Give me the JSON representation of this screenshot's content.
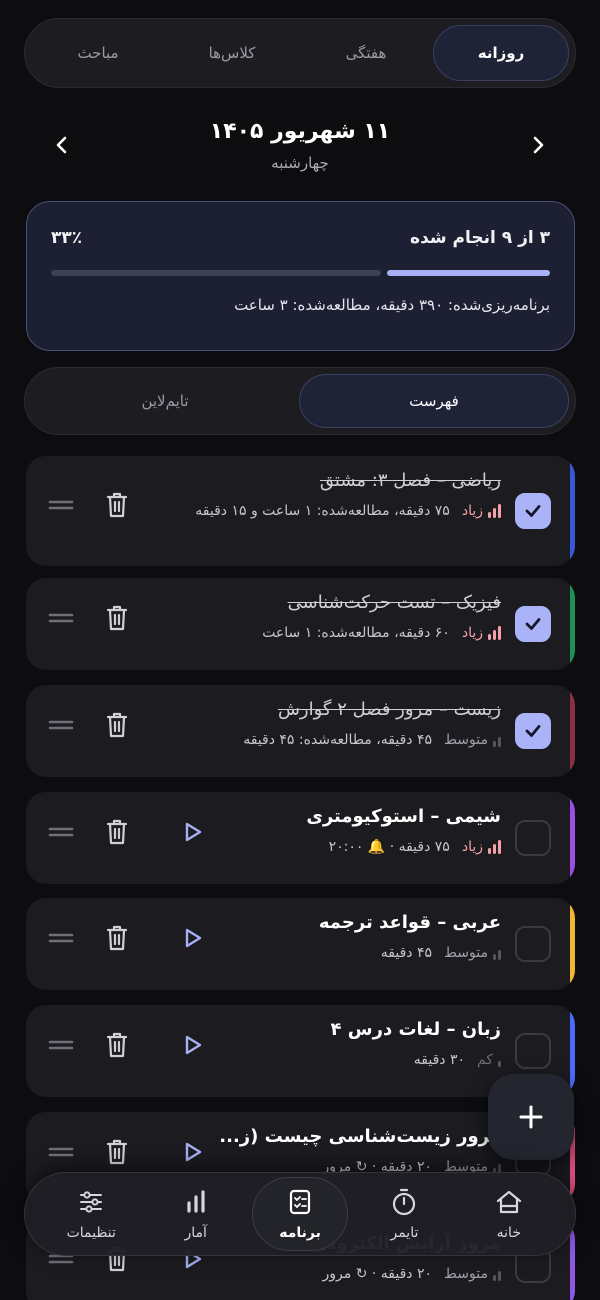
{
  "view_tabs": [
    {
      "label": "روزانه",
      "active": true
    },
    {
      "label": "هفتگی",
      "active": false
    },
    {
      "label": "کلاس‌ها",
      "active": false
    },
    {
      "label": "مباحث",
      "active": false
    }
  ],
  "date": {
    "title": "۱۱ شهریور ۱۴۰۵",
    "weekday": "چهارشنبه"
  },
  "progress": {
    "done_text": "۳ از ۹ انجام شده",
    "percent_text": "۳۳٪",
    "fraction": 0.33,
    "summary": "برنامه‌ریزی‌شده: ۳۹۰ دقیقه، مطالعه‌شده: ۳ ساعت"
  },
  "mode_toggle": {
    "list": "فهرست",
    "timeline": "تایم‌لاین"
  },
  "priority_labels": {
    "high": "زیاد",
    "mid": "متوسط",
    "low": "کم"
  },
  "tasks": [
    {
      "title": "ریاضی – فصل ۳: مشتق",
      "done": true,
      "priority": "زیاد",
      "meta": "۷۵ دقیقه، مطالعه‌شده: ۱ ساعت و ۱۵ دقیقه",
      "color": "#3b57d6"
    },
    {
      "title": "فیزیک – تست حرکت‌شناسی",
      "done": true,
      "priority": "زیاد",
      "meta": "۶۰ دقیقه، مطالعه‌شده: ۱ ساعت",
      "color": "#1f8f58"
    },
    {
      "title": "زیست – مرور فصل ۲ گوارش",
      "done": true,
      "priority": "متوسط",
      "meta": "۴۵ دقیقه، مطالعه‌شده: ۴۵ دقیقه",
      "color": "#8c2f45"
    },
    {
      "title": "شیمی – استوکیومتری",
      "done": false,
      "priority": "زیاد",
      "meta": "۷۵ دقیقه · 🔔 ۲۰:۰۰",
      "color": "#9a4fe0"
    },
    {
      "title": "عربی – قواعد ترجمه",
      "done": false,
      "priority": "متوسط",
      "meta": "۴۵ دقیقه",
      "color": "#f2b632"
    },
    {
      "title": "زبان – لغات درس ۴",
      "done": false,
      "priority": "کم",
      "meta": "۳۰ دقیقه",
      "color": "#4b6bff"
    },
    {
      "title": "مرور زیست‌شناسی چیست (ز...",
      "done": false,
      "priority": "متوسط",
      "meta": "۲۰ دقیقه · ↻ مرور",
      "color": "#e64f82"
    },
    {
      "title": "مرور آرایش الکترونی",
      "done": false,
      "priority": "متوسط",
      "meta": "۲۰ دقیقه · ↻ مرور",
      "color": "#8e57e6"
    }
  ],
  "bottom_nav": [
    {
      "label": "خانه",
      "icon": "home-icon",
      "active": false
    },
    {
      "label": "تایمر",
      "icon": "timer-icon",
      "active": false
    },
    {
      "label": "برنامه",
      "icon": "planner-icon",
      "active": true
    },
    {
      "label": "آمار",
      "icon": "stats-icon",
      "active": false
    },
    {
      "label": "تنظیمات",
      "icon": "settings-icon",
      "active": false
    }
  ],
  "colors": {
    "accent": "#aab2f8",
    "high_priority": "#f4a3a8"
  }
}
